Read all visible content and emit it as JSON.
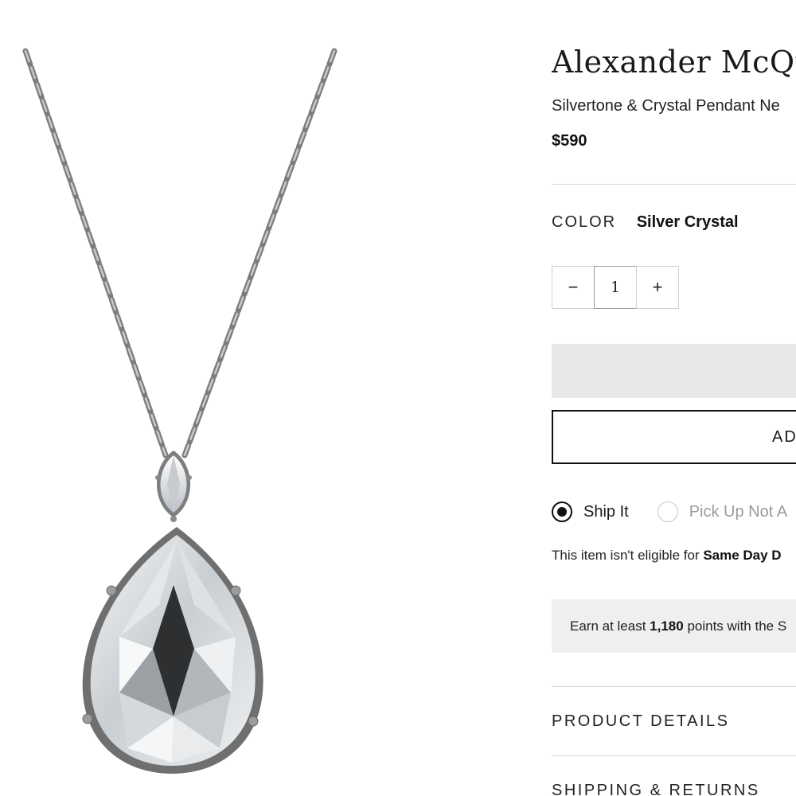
{
  "product": {
    "brand": "Alexander McQue",
    "name": "Silvertone & Crystal Pendant Ne",
    "price": "$590"
  },
  "color": {
    "label": "COLOR",
    "value": "Silver Crystal"
  },
  "quantity": {
    "decrement": "−",
    "value": "1",
    "increment": "+"
  },
  "buttons": {
    "primary_label": "",
    "secondary_label": "AD"
  },
  "fulfillment": {
    "options": [
      {
        "label": "Ship It",
        "selected": true
      },
      {
        "label": "Pick Up Not A",
        "selected": false
      }
    ],
    "eligibility_prefix": "This item isn't eligible for ",
    "eligibility_bold": "Same Day D"
  },
  "points": {
    "prefix": "Earn at least ",
    "value": "1,180",
    "suffix": " points with the S"
  },
  "accordions": {
    "product_details": "PRODUCT DETAILS",
    "shipping_returns": "SHIPPING & RETURNS"
  },
  "image": {
    "subject": "crystal-pendant-necklace",
    "metal_color": "#8a8a8a",
    "crystal_color": "#d9dde0"
  }
}
